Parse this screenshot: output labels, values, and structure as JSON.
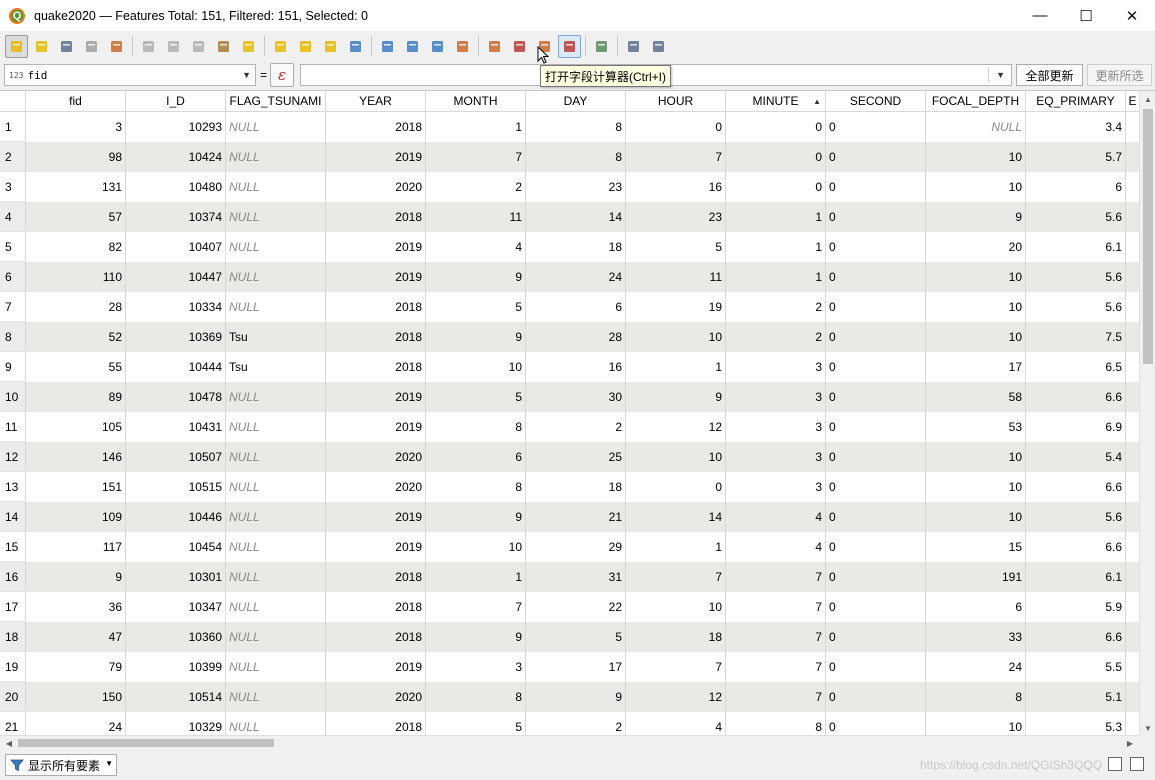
{
  "window": {
    "title": "quake2020 — Features Total: 151, Filtered: 151, Selected: 0",
    "minimize": "—",
    "maximize": "☐",
    "close": "✕",
    "logo": "Q"
  },
  "toolbar": {
    "buttons": [
      {
        "name": "toggle-editing-icon",
        "color": "#e6b800"
      },
      {
        "name": "toggle-multiedit-icon",
        "color": "#e6b800"
      },
      {
        "name": "save-edits-icon",
        "color": "#5a6e8a"
      },
      {
        "name": "reload-table-icon",
        "color": "#a0a0a0"
      },
      {
        "name": "add-feature-icon",
        "color": "#c96a2a"
      },
      {
        "name": "delete-feature-icon",
        "color": "#b0b0b0"
      },
      {
        "name": "cut-icon",
        "color": "#b0b0b0"
      },
      {
        "name": "copy-icon",
        "color": "#b0b0b0"
      },
      {
        "name": "paste-icon",
        "color": "#a47c3a"
      },
      {
        "name": "select-by-expression-icon",
        "color": "#e6b800"
      },
      {
        "name": "select-all-icon",
        "color": "#e6b800"
      },
      {
        "name": "invert-selection-icon",
        "color": "#e6b800"
      },
      {
        "name": "deselect-all-icon",
        "color": "#e6b800"
      },
      {
        "name": "filter-icon",
        "color": "#3d7bbf"
      },
      {
        "name": "move-selection-top-icon",
        "color": "#3d7bbf"
      },
      {
        "name": "pan-to-selection-icon",
        "color": "#3d7bbf"
      },
      {
        "name": "zoom-to-selection-icon",
        "color": "#3d7bbf"
      },
      {
        "name": "copy-selected-rows-icon",
        "color": "#c96a2a"
      },
      {
        "name": "new-field-icon",
        "color": "#c96a2a"
      },
      {
        "name": "delete-field-icon",
        "color": "#b83a3a"
      },
      {
        "name": "conditional-format-icon",
        "color": "#c96a2a"
      },
      {
        "name": "field-calculator-icon",
        "color": "#b83a3a"
      },
      {
        "name": "dock-icon",
        "color": "#5a8a5a"
      },
      {
        "name": "actions-icon",
        "color": "#5a6e8a"
      },
      {
        "name": "zoom-map-icon",
        "color": "#5a6e8a"
      }
    ]
  },
  "expression_bar": {
    "field_type": "123",
    "field": "fid",
    "equals": "=",
    "expression_button": "ε",
    "expression_value": "",
    "update_all": "全部更新",
    "update_selected": "更新所选"
  },
  "tooltip": "打开字段计算器(Ctrl+I)",
  "table": {
    "columns": [
      "fid",
      "I_D",
      "FLAG_TSUNAMI",
      "YEAR",
      "MONTH",
      "DAY",
      "HOUR",
      "MINUTE",
      "SECOND",
      "FOCAL_DEPTH",
      "EQ_PRIMARY",
      "E"
    ],
    "sorted_column": "MINUTE",
    "sort_arrow": "▲",
    "rows": [
      {
        "n": "1",
        "cells": [
          "3",
          "10293",
          "NULL",
          "2018",
          "1",
          "8",
          "0",
          "0",
          "0",
          "NULL",
          "3.4"
        ]
      },
      {
        "n": "2",
        "cells": [
          "98",
          "10424",
          "NULL",
          "2019",
          "7",
          "8",
          "7",
          "0",
          "0",
          "10",
          "5.7"
        ]
      },
      {
        "n": "3",
        "cells": [
          "131",
          "10480",
          "NULL",
          "2020",
          "2",
          "23",
          "16",
          "0",
          "0",
          "10",
          "6"
        ]
      },
      {
        "n": "4",
        "cells": [
          "57",
          "10374",
          "NULL",
          "2018",
          "11",
          "14",
          "23",
          "1",
          "0",
          "9",
          "5.6"
        ]
      },
      {
        "n": "5",
        "cells": [
          "82",
          "10407",
          "NULL",
          "2019",
          "4",
          "18",
          "5",
          "1",
          "0",
          "20",
          "6.1"
        ]
      },
      {
        "n": "6",
        "cells": [
          "110",
          "10447",
          "NULL",
          "2019",
          "9",
          "24",
          "11",
          "1",
          "0",
          "10",
          "5.6"
        ]
      },
      {
        "n": "7",
        "cells": [
          "28",
          "10334",
          "NULL",
          "2018",
          "5",
          "6",
          "19",
          "2",
          "0",
          "10",
          "5.6"
        ]
      },
      {
        "n": "8",
        "cells": [
          "52",
          "10369",
          "Tsu",
          "2018",
          "9",
          "28",
          "10",
          "2",
          "0",
          "10",
          "7.5"
        ]
      },
      {
        "n": "9",
        "cells": [
          "55",
          "10444",
          "Tsu",
          "2018",
          "10",
          "16",
          "1",
          "3",
          "0",
          "17",
          "6.5"
        ]
      },
      {
        "n": "10",
        "cells": [
          "89",
          "10478",
          "NULL",
          "2019",
          "5",
          "30",
          "9",
          "3",
          "0",
          "58",
          "6.6"
        ]
      },
      {
        "n": "11",
        "cells": [
          "105",
          "10431",
          "NULL",
          "2019",
          "8",
          "2",
          "12",
          "3",
          "0",
          "53",
          "6.9"
        ]
      },
      {
        "n": "12",
        "cells": [
          "146",
          "10507",
          "NULL",
          "2020",
          "6",
          "25",
          "10",
          "3",
          "0",
          "10",
          "5.4"
        ]
      },
      {
        "n": "13",
        "cells": [
          "151",
          "10515",
          "NULL",
          "2020",
          "8",
          "18",
          "0",
          "3",
          "0",
          "10",
          "6.6"
        ]
      },
      {
        "n": "14",
        "cells": [
          "109",
          "10446",
          "NULL",
          "2019",
          "9",
          "21",
          "14",
          "4",
          "0",
          "10",
          "5.6"
        ]
      },
      {
        "n": "15",
        "cells": [
          "117",
          "10454",
          "NULL",
          "2019",
          "10",
          "29",
          "1",
          "4",
          "0",
          "15",
          "6.6"
        ]
      },
      {
        "n": "16",
        "cells": [
          "9",
          "10301",
          "NULL",
          "2018",
          "1",
          "31",
          "7",
          "7",
          "0",
          "191",
          "6.1"
        ]
      },
      {
        "n": "17",
        "cells": [
          "36",
          "10347",
          "NULL",
          "2018",
          "7",
          "22",
          "10",
          "7",
          "0",
          "6",
          "5.9"
        ]
      },
      {
        "n": "18",
        "cells": [
          "47",
          "10360",
          "NULL",
          "2018",
          "9",
          "5",
          "18",
          "7",
          "0",
          "33",
          "6.6"
        ]
      },
      {
        "n": "19",
        "cells": [
          "79",
          "10399",
          "NULL",
          "2019",
          "3",
          "17",
          "7",
          "7",
          "0",
          "24",
          "5.5"
        ]
      },
      {
        "n": "20",
        "cells": [
          "150",
          "10514",
          "NULL",
          "2020",
          "8",
          "9",
          "12",
          "7",
          "0",
          "8",
          "5.1"
        ]
      },
      {
        "n": "21",
        "cells": [
          "24",
          "10329",
          "NULL",
          "2018",
          "5",
          "2",
          "4",
          "8",
          "0",
          "10",
          "5.3"
        ]
      }
    ]
  },
  "bottom": {
    "show_all": "显示所有要素",
    "watermark": "https://blog.csdn.net/QGISh3QQQ"
  }
}
